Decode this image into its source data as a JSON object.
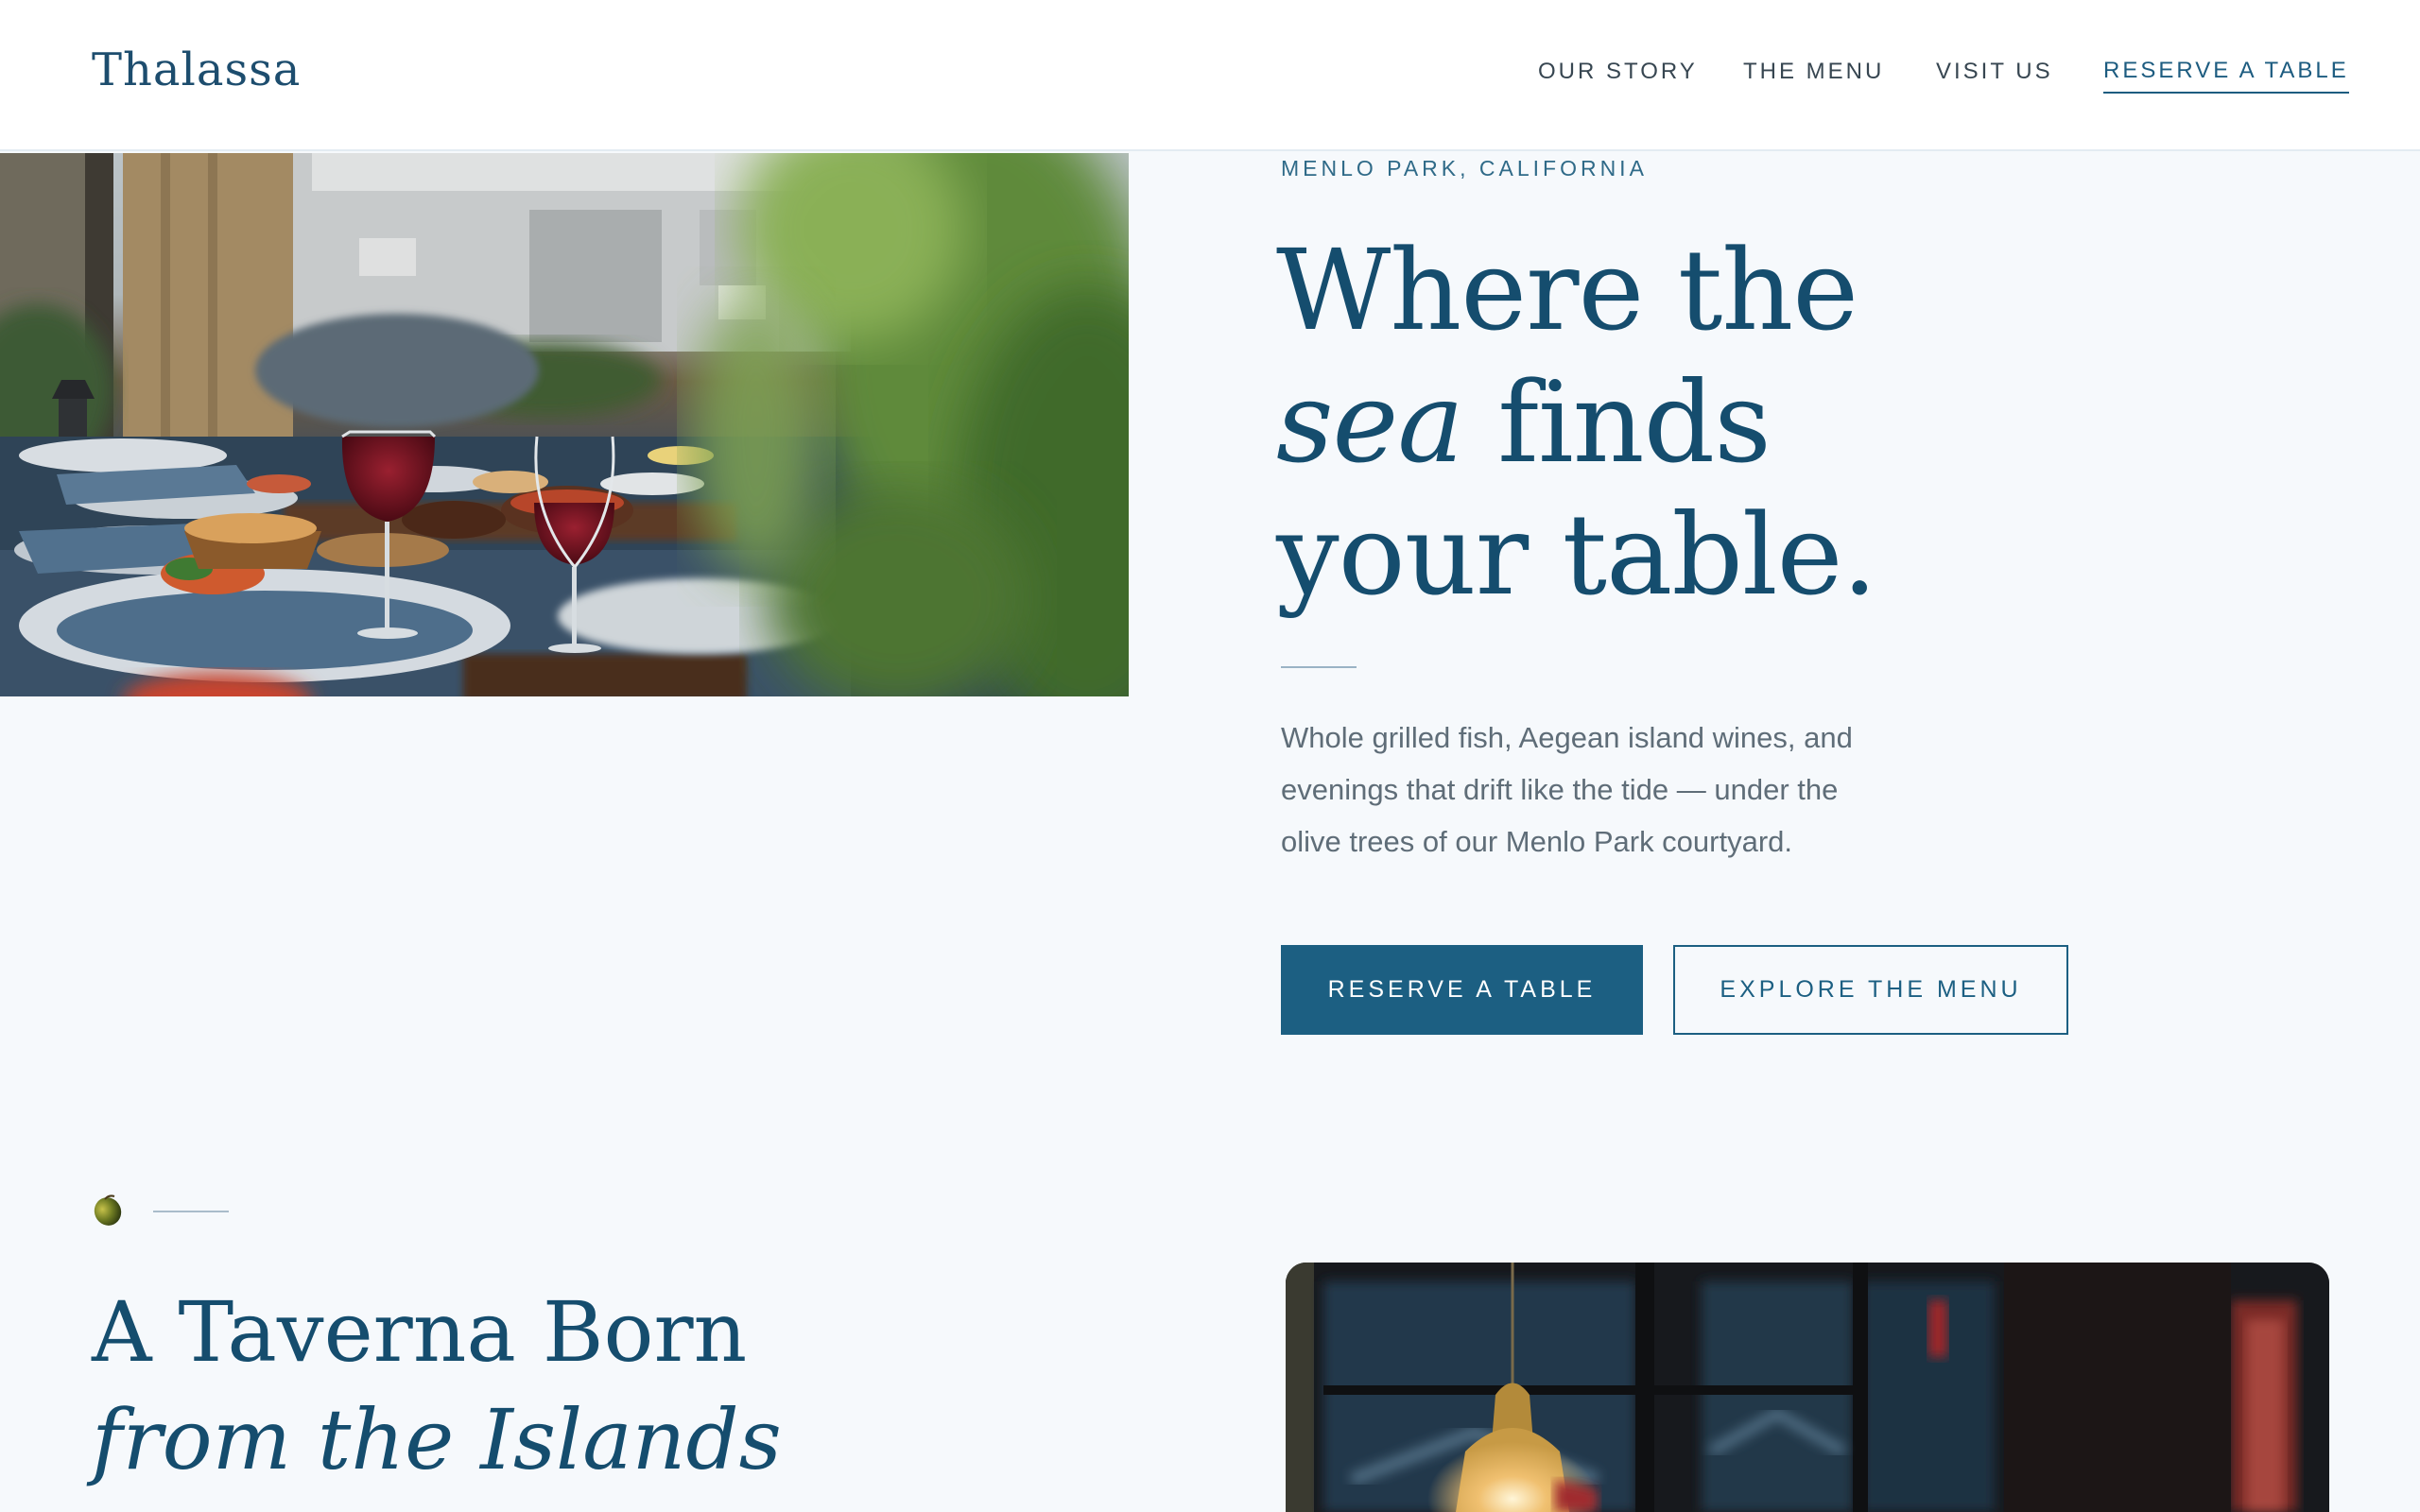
{
  "brand": {
    "name": "Thalassa"
  },
  "nav": {
    "items": [
      "OUR STORY",
      "THE MENU",
      "VISIT US"
    ],
    "cta": "RESERVE A TABLE"
  },
  "hero": {
    "eyebrow": "MENLO PARK, CALIFORNIA",
    "headline": {
      "line1": "Where the",
      "line2_italic": "sea",
      "line2_rest": "finds",
      "line3": "your table."
    },
    "description_lines": [
      "Whole grilled fish, Aegean island wines, and",
      "evenings that drift like the tide — under the",
      "olive trees of our Menlo Park courtyard."
    ],
    "primary_button": "RESERVE A TABLE",
    "secondary_button": "EXPLORE THE MENU",
    "photo_icon": "dining-table-photo"
  },
  "story": {
    "marker_icon": "olive-icon",
    "heading_line1": "A Taverna Born",
    "heading_line2": "from the Islands",
    "photo_icon": "taverna-interior-photo"
  },
  "colors": {
    "background": "#f6f9fc",
    "primary": "#1c5f82",
    "heading": "#154d6e",
    "body_text": "#5f6d78"
  }
}
